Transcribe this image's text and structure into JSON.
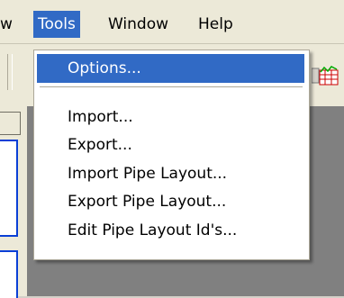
{
  "menubar": {
    "items": [
      {
        "label": "w"
      },
      {
        "label": "Tools"
      },
      {
        "label": "Window"
      },
      {
        "label": "Help"
      }
    ],
    "active_index": 1
  },
  "tools_menu": {
    "items": [
      {
        "label": "Options..."
      },
      {
        "label": "Import..."
      },
      {
        "label": "Export..."
      },
      {
        "label": "Import Pipe Layout..."
      },
      {
        "label": "Export Pipe Layout..."
      },
      {
        "label": "Edit Pipe Layout Id's..."
      }
    ],
    "highlighted_index": 0
  },
  "colors": {
    "highlight": "#316ac5",
    "menubar_bg": "#ece9d8",
    "workspace_bg": "#808080"
  },
  "icons": {
    "toolbar": "grid-chart-icon"
  }
}
